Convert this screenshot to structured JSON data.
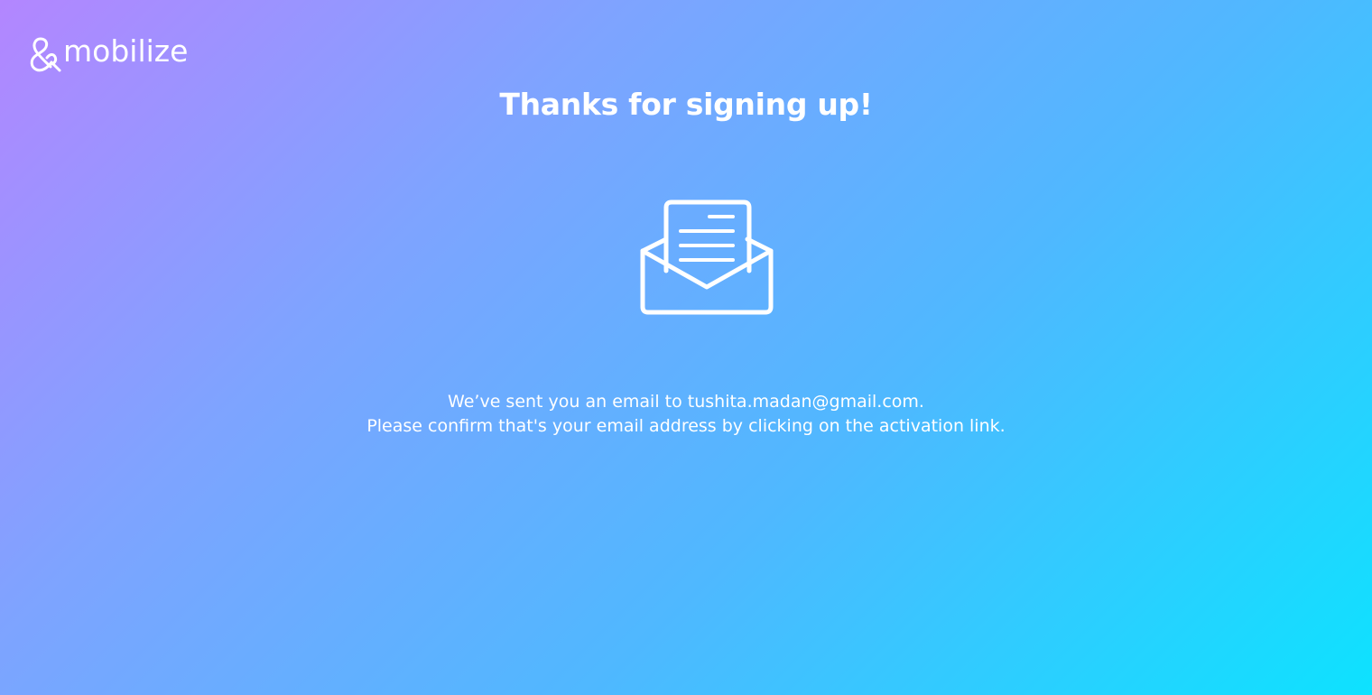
{
  "brand": {
    "name": "mobilize",
    "logo_icon": "ampersand-logo-icon"
  },
  "page": {
    "title": "Thanks for signing up!",
    "illustration": "open-envelope-icon",
    "message_line1": "We’ve sent you an email to tushita.madan@gmail.com.",
    "message_line2": "Please confirm that's your email address by clicking on the activation link."
  },
  "colors": {
    "gradient_start": "#b386ff",
    "gradient_end": "#0de2ff",
    "text": "#ffffff"
  }
}
